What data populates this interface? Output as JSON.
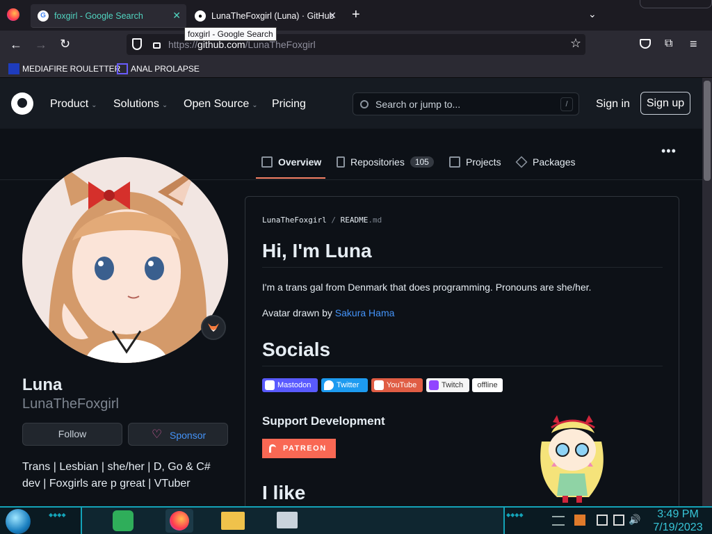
{
  "browser": {
    "tabs": [
      {
        "title": "foxgirl - Google Search",
        "active": true
      },
      {
        "title": "LunaTheFoxgirl (Luna) · GitHub",
        "active": false
      }
    ],
    "tooltip": "foxgirl - Google Search",
    "url_prefix": "https://",
    "url_host": "github.com",
    "url_path": "/LunaTheFoxgirl",
    "bookmarks": [
      {
        "label": "MEDIAFIRE ROULETTER",
        "icon": "mediafire-icon"
      },
      {
        "label": "ANAL PROLAPSE",
        "icon": "bookmark-x-icon"
      }
    ]
  },
  "github": {
    "nav": [
      "Product",
      "Solutions",
      "Open Source",
      "Pricing"
    ],
    "search_placeholder": "Search or jump to...",
    "search_key": "/",
    "sign_in": "Sign in",
    "sign_up": "Sign up",
    "tabs": {
      "overview": "Overview",
      "repositories": "Repositories",
      "repo_count": "105",
      "projects": "Projects",
      "packages": "Packages"
    }
  },
  "profile": {
    "name": "Luna",
    "username": "LunaTheFoxgirl",
    "follow": "Follow",
    "sponsor": "Sponsor",
    "bio": "Trans | Lesbian | she/her | D, Go & C# dev | Foxgirls are p great | VTuber"
  },
  "readme": {
    "path_owner": "LunaTheFoxgirl",
    "path_sep": "/",
    "path_file": "README",
    "path_ext": ".md",
    "heading": "Hi, I'm Luna",
    "intro": "I'm a trans gal from Denmark that does programming. Pronouns are she/her.",
    "avatar_credit_prefix": "Avatar drawn by ",
    "avatar_credit_link": "Sakura Hama",
    "socials_heading": "Socials",
    "badges": [
      {
        "label": "Mastodon",
        "color": "#595aff"
      },
      {
        "label": "Twitter",
        "color": "#1d9bf0"
      },
      {
        "label": "YouTube",
        "color": "#e05d44"
      },
      {
        "label": "Twitch",
        "color": "#f5f5f5"
      },
      {
        "label": "offline",
        "color": "#ffffff"
      }
    ],
    "support_heading": "Support Development",
    "patreon": "PATREON",
    "like_heading": "I like"
  },
  "taskbar": {
    "time": "3:49 PM",
    "date": "7/19/2023",
    "accent": "#14a3b8"
  }
}
